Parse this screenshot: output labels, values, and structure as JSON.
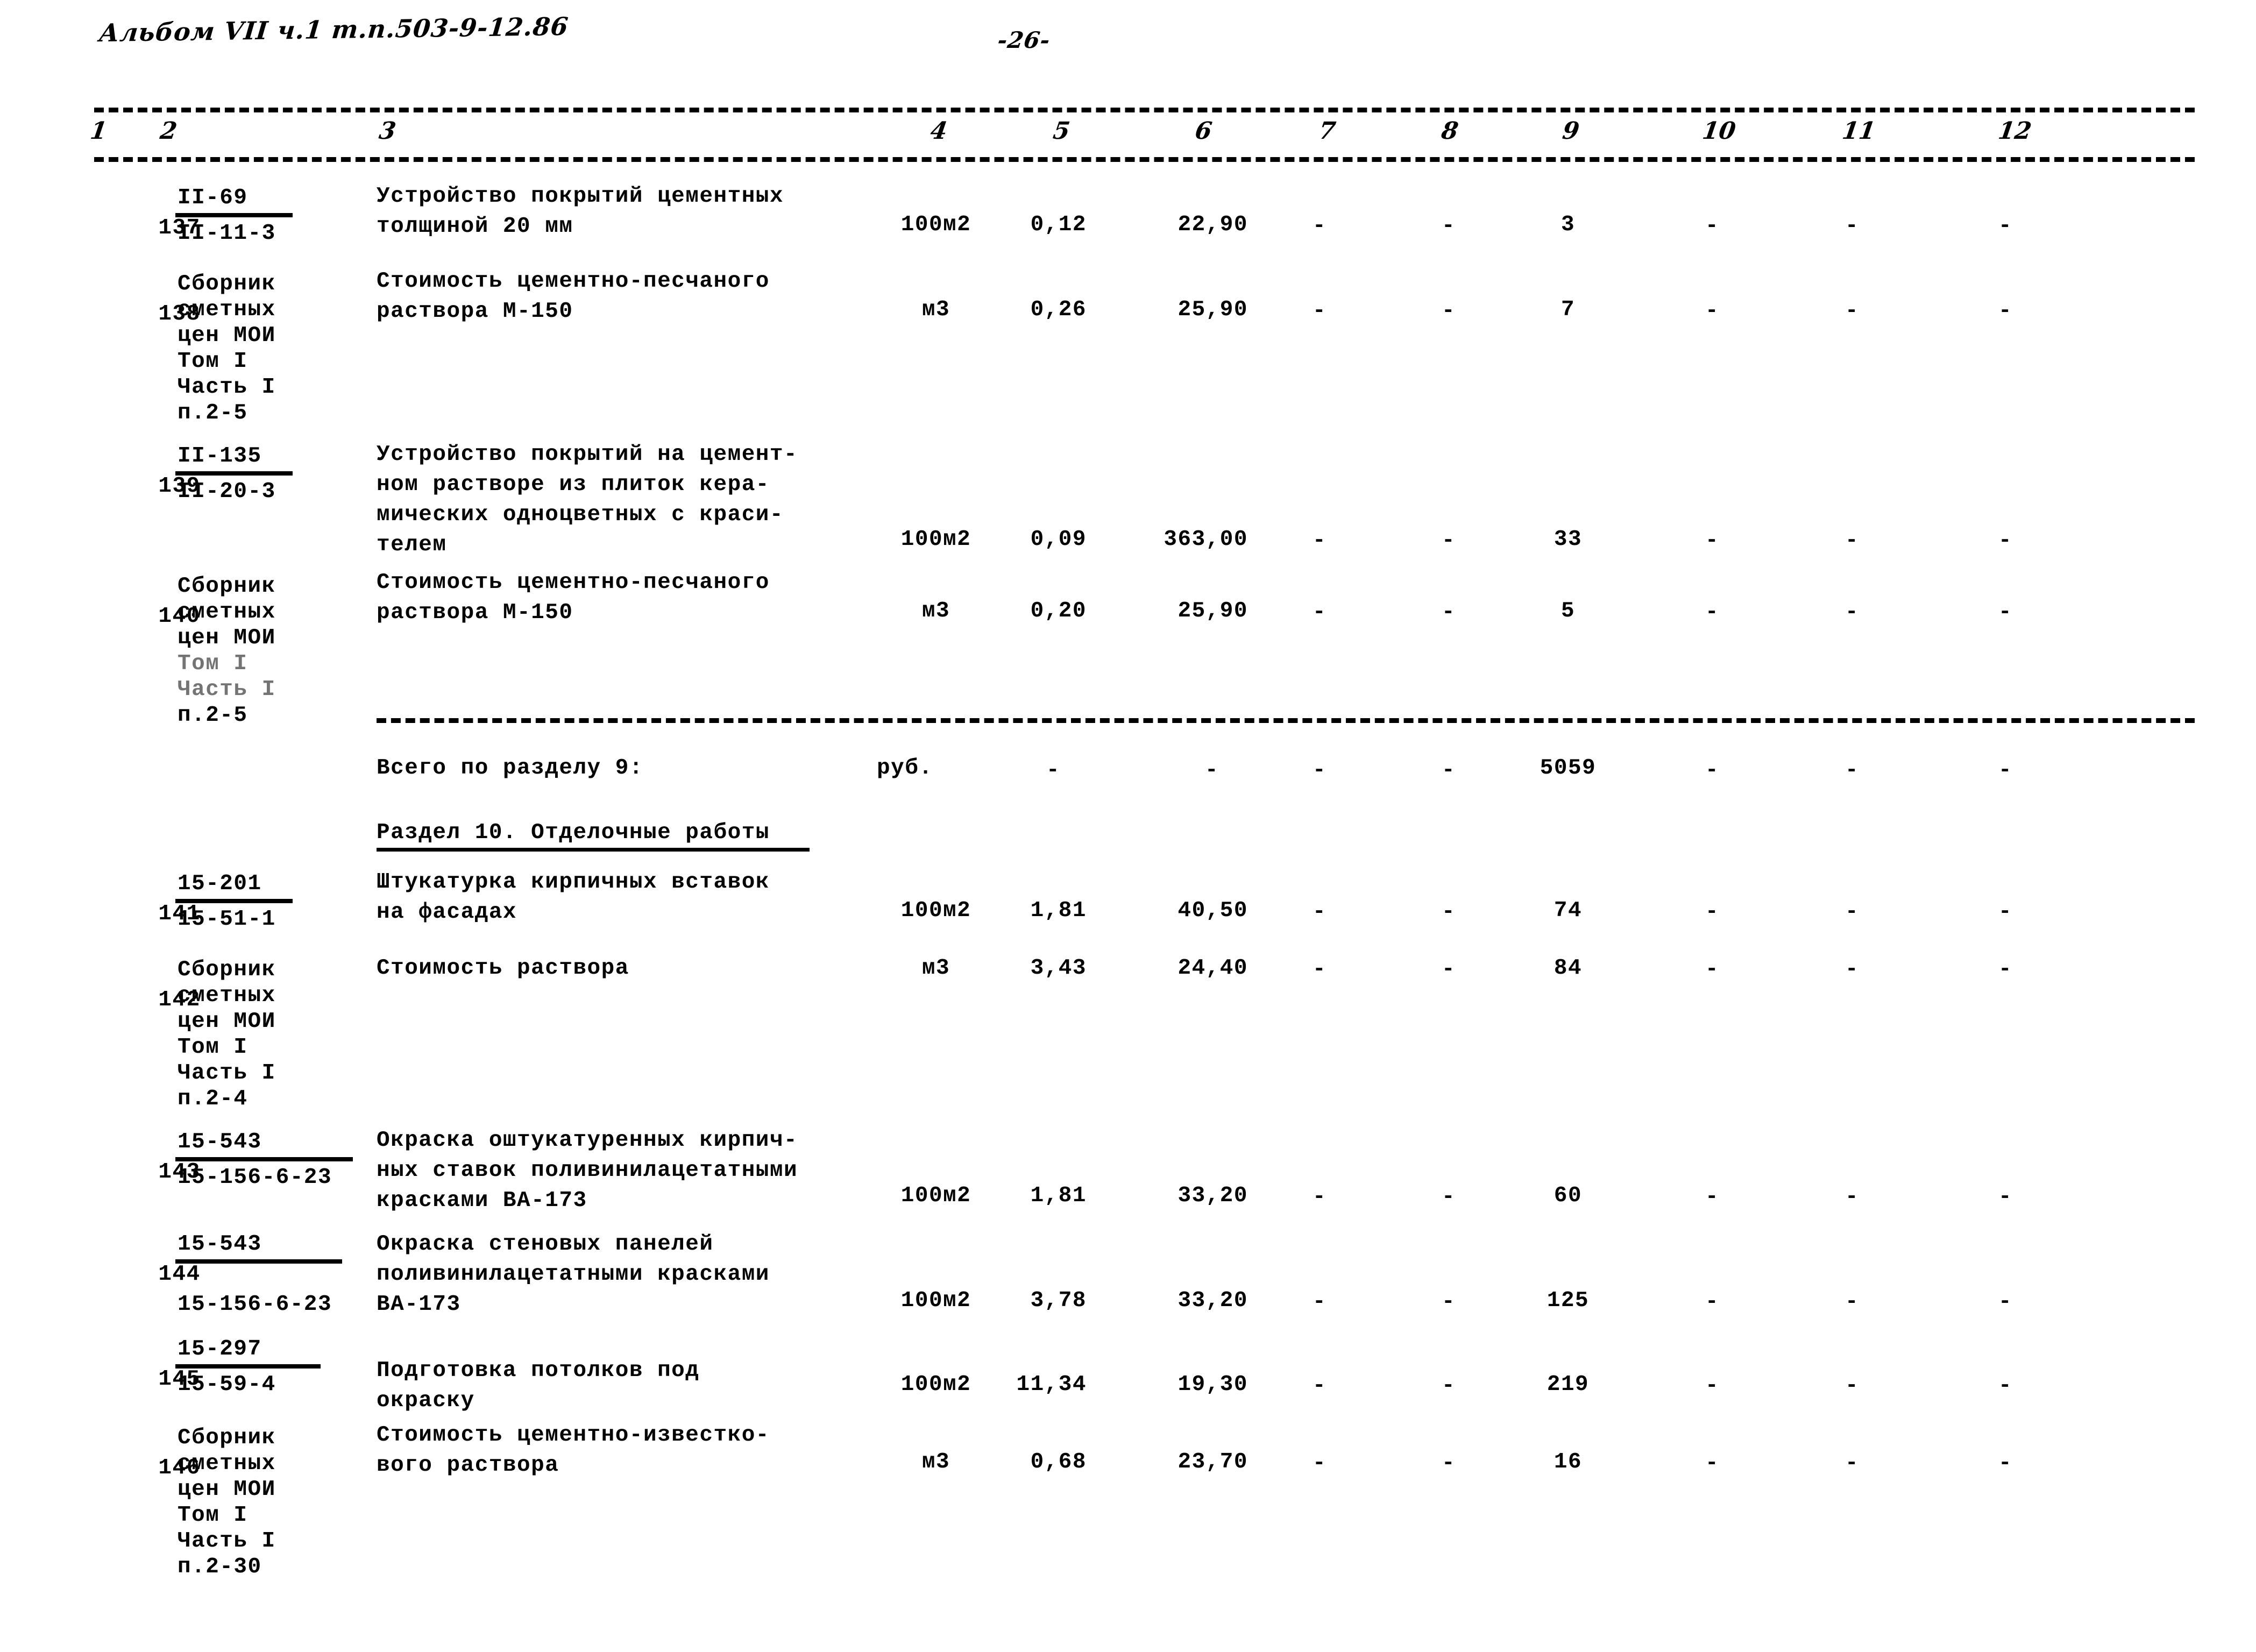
{
  "document": {
    "header_note": "Альбом VII ч.1 т.п.503-9-12.86",
    "page_number": "-26-"
  },
  "table": {
    "column_headers": [
      "1",
      "2",
      "3",
      "4",
      "5",
      "6",
      "7",
      "8",
      "9",
      "10",
      "11",
      "12"
    ],
    "empty_mark": "-",
    "rows": [
      {
        "no": "137",
        "code_top": "II-69",
        "code_bottom": "II-11-3",
        "has_fraction_bar": true,
        "description": [
          "Устройство покрытий цементных",
          "толщиной 20 мм"
        ],
        "unit": "100м2",
        "qty": "0,12",
        "price": "22,90",
        "c7": "-",
        "c8": "-",
        "c9": "3",
        "c10": "-",
        "c11": "-",
        "c12": "-"
      },
      {
        "no": "138",
        "source_lines": [
          "Сборник",
          "сметных",
          "цен МОИ",
          "Том I",
          "Часть I",
          "п.2-5"
        ],
        "description": [
          "Стоимость цементно-песчаного",
          "раствора М-150"
        ],
        "unit": "м3",
        "qty": "0,26",
        "price": "25,90",
        "c7": "-",
        "c8": "-",
        "c9": "7",
        "c10": "-",
        "c11": "-",
        "c12": "-"
      },
      {
        "no": "139",
        "code_top": "II-135",
        "code_bottom": "II-20-3",
        "has_fraction_bar": true,
        "description": [
          "Устройство покрытий на цемент-",
          "ном растворе из плиток кера-",
          "мических одноцветных с краси-",
          "телем"
        ],
        "unit": "100м2",
        "qty": "0,09",
        "price": "363,00",
        "c7": "-",
        "c8": "-",
        "c9": "33",
        "c10": "-",
        "c11": "-",
        "c12": "-"
      },
      {
        "no": "140",
        "source_lines": [
          "Сборник",
          "сметных",
          "цен МОИ",
          "Том I",
          "Часть I",
          "п.2-5"
        ],
        "description": [
          "Стоимость цементно-песчаного",
          "раствора М-150"
        ],
        "unit": "м3",
        "qty": "0,20",
        "price": "25,90",
        "c7": "-",
        "c8": "-",
        "c9": "5",
        "c10": "-",
        "c11": "-",
        "c12": "-"
      },
      {
        "no": "141",
        "code_top": "15-201",
        "code_bottom": "15-51-1",
        "has_fraction_bar": true,
        "description": [
          "Штукатурка кирпичных вставок",
          "на фасадах"
        ],
        "unit": "100м2",
        "qty": "1,81",
        "price": "40,50",
        "c7": "-",
        "c8": "-",
        "c9": "74",
        "c10": "-",
        "c11": "-",
        "c12": "-"
      },
      {
        "no": "142",
        "source_lines": [
          "Сборник",
          "сметных",
          "цен МОИ",
          "Том I",
          "Часть I",
          "п.2-4"
        ],
        "description": [
          "Стоимость раствора"
        ],
        "unit": "м3",
        "qty": "3,43",
        "price": "24,40",
        "c7": "-",
        "c8": "-",
        "c9": "84",
        "c10": "-",
        "c11": "-",
        "c12": "-"
      },
      {
        "no": "143",
        "code_top": "15-543",
        "code_bottom": "15-156-6-23",
        "has_fraction_bar": true,
        "description": [
          "Окраска оштукатуренных кирпич-",
          "ных ставок поливинилацетатными",
          "красками ВА-173"
        ],
        "unit": "100м2",
        "qty": "1,81",
        "price": "33,20",
        "c7": "-",
        "c8": "-",
        "c9": "60",
        "c10": "-",
        "c11": "-",
        "c12": "-"
      },
      {
        "no": "144",
        "code_top": "15-543",
        "code_bottom": "15-156-6-23",
        "has_fraction_bar": true,
        "description": [
          "Окраска стеновых панелей",
          "поливинилацетатными красками",
          "ВА-173"
        ],
        "unit": "100м2",
        "qty": "3,78",
        "price": "33,20",
        "c7": "-",
        "c8": "-",
        "c9": "125",
        "c10": "-",
        "c11": "-",
        "c12": "-"
      },
      {
        "no": "145",
        "code_top": "15-297",
        "code_bottom": "15-59-4",
        "has_fraction_bar": true,
        "description": [
          "Подготовка потолков под",
          "окраску"
        ],
        "unit": "100м2",
        "qty": "11,34",
        "price": "19,30",
        "c7": "-",
        "c8": "-",
        "c9": "219",
        "c10": "-",
        "c11": "-",
        "c12": "-"
      },
      {
        "no": "146",
        "source_lines": [
          "Сборник",
          "сметных",
          "цен МОИ",
          "Том I",
          "Часть I",
          "п.2-30"
        ],
        "description": [
          "Стоимость цементно-известко-",
          "вого раствора"
        ],
        "unit": "м3",
        "qty": "0,68",
        "price": "23,70",
        "c7": "-",
        "c8": "-",
        "c9": "16",
        "c10": "-",
        "c11": "-",
        "c12": "-"
      }
    ],
    "subtotal": {
      "label": "Всего по разделу 9:",
      "unit": "руб.",
      "qty": "-",
      "price": "-",
      "c7": "-",
      "c8": "-",
      "c9": "5059",
      "c10": "-",
      "c11": "-",
      "c12": "-"
    },
    "section_heading": "Раздел 10. Отделочные работы"
  }
}
